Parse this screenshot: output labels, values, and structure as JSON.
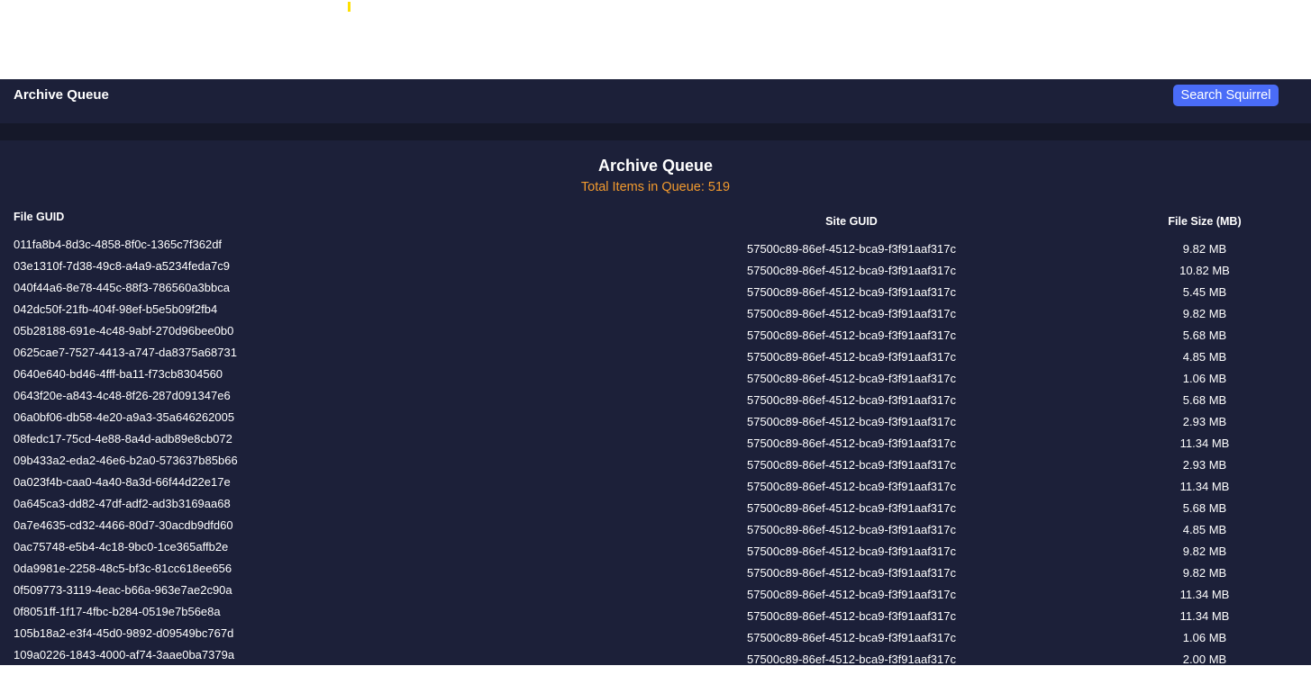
{
  "header": {
    "title": "Archive Queue",
    "search_button": "Search Squirrel"
  },
  "main": {
    "title": "Archive Queue",
    "queue_count": "Total Items in Queue: 519"
  },
  "table": {
    "headers": {
      "file_guid": "File GUID",
      "site_guid": "Site GUID",
      "file_size": "File Size (MB)"
    },
    "file_guids": [
      "011fa8b4-8d3c-4858-8f0c-1365c7f362df",
      "03e1310f-7d38-49c8-a4a9-a5234feda7c9",
      "040f44a6-8e78-445c-88f3-786560a3bbca",
      "042dc50f-21fb-404f-98ef-b5e5b09f2fb4",
      "05b28188-691e-4c48-9abf-270d96bee0b0",
      "0625cae7-7527-4413-a747-da8375a68731",
      "0640e640-bd46-4fff-ba11-f73cb8304560",
      "0643f20e-a843-4c48-8f26-287d091347e6",
      "06a0bf06-db58-4e20-a9a3-35a646262005",
      "08fedc17-75cd-4e88-8a4d-adb89e8cb072",
      "09b433a2-eda2-46e6-b2a0-573637b85b66",
      "0a023f4b-caa0-4a40-8a3d-66f44d22e17e",
      "0a645ca3-dd82-47df-adf2-ad3b3169aa68",
      "0a7e4635-cd32-4466-80d7-30acdb9dfd60",
      "0ac75748-e5b4-4c18-9bc0-1ce365affb2e",
      "0da9981e-2258-48c5-bf3c-81cc618ee656",
      "0f509773-3119-4eac-b66a-963e7ae2c90a",
      "0f8051ff-1f17-4fbc-b284-0519e7b56e8a",
      "105b18a2-e3f4-45d0-9892-d09549bc767d",
      "109a0226-1843-4000-af74-3aae0ba7379a"
    ],
    "site_guids": [
      "57500c89-86ef-4512-bca9-f3f91aaf317c",
      "57500c89-86ef-4512-bca9-f3f91aaf317c",
      "57500c89-86ef-4512-bca9-f3f91aaf317c",
      "57500c89-86ef-4512-bca9-f3f91aaf317c",
      "57500c89-86ef-4512-bca9-f3f91aaf317c",
      "57500c89-86ef-4512-bca9-f3f91aaf317c",
      "57500c89-86ef-4512-bca9-f3f91aaf317c",
      "57500c89-86ef-4512-bca9-f3f91aaf317c",
      "57500c89-86ef-4512-bca9-f3f91aaf317c",
      "57500c89-86ef-4512-bca9-f3f91aaf317c",
      "57500c89-86ef-4512-bca9-f3f91aaf317c",
      "57500c89-86ef-4512-bca9-f3f91aaf317c",
      "57500c89-86ef-4512-bca9-f3f91aaf317c",
      "57500c89-86ef-4512-bca9-f3f91aaf317c",
      "57500c89-86ef-4512-bca9-f3f91aaf317c",
      "57500c89-86ef-4512-bca9-f3f91aaf317c",
      "57500c89-86ef-4512-bca9-f3f91aaf317c",
      "57500c89-86ef-4512-bca9-f3f91aaf317c",
      "57500c89-86ef-4512-bca9-f3f91aaf317c",
      "57500c89-86ef-4512-bca9-f3f91aaf317c"
    ],
    "file_sizes": [
      "9.82 MB",
      "10.82 MB",
      "5.45 MB",
      "9.82 MB",
      "5.68 MB",
      "4.85 MB",
      "1.06 MB",
      "5.68 MB",
      "2.93 MB",
      "11.34 MB",
      "2.93 MB",
      "11.34 MB",
      "5.68 MB",
      "4.85 MB",
      "9.82 MB",
      "9.82 MB",
      "11.34 MB",
      "11.34 MB",
      "1.06 MB",
      "2.00 MB"
    ]
  },
  "colors": {
    "background": "#1c2039",
    "band": "#151829",
    "accent_button": "#4a6cf7",
    "queue_count": "#f29a2e",
    "caret_mark": "#ffe000"
  }
}
